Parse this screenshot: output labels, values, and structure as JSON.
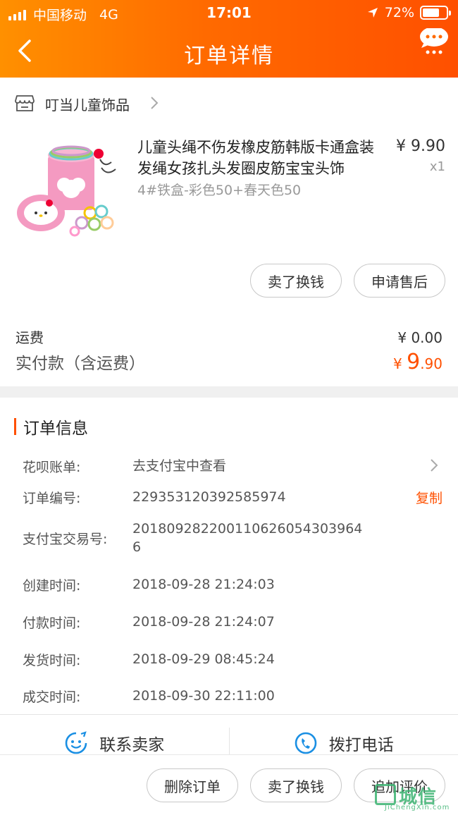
{
  "status_bar": {
    "carrier": "中国移动",
    "network": "4G",
    "time": "17:01",
    "battery": "72%",
    "battery_level": 0.72
  },
  "navbar": {
    "title": "订单详情"
  },
  "shop": {
    "name": "叮当儿童饰品"
  },
  "product": {
    "title": "儿童头绳不伤发橡皮筋韩版卡通盒装发绳女孩扎头发圈皮筋宝宝头饰",
    "variant": "4#铁盒-彩色50+春天色50",
    "price": "¥ 9.90",
    "qty": "x1"
  },
  "item_actions": {
    "sell": "卖了换钱",
    "after_sale": "申请售后"
  },
  "fees": {
    "shipping_label": "运费",
    "shipping_value": "¥ 0.00",
    "total_label": "实付款（含运费）",
    "total_currency": "¥ ",
    "total_int": "9",
    "total_dec": ".90"
  },
  "order_info": {
    "title": "订单信息",
    "huabei_label": "花呗账单:",
    "huabei_value": "去支付宝中查看",
    "order_no_label": "订单编号:",
    "order_no_value": "229353120392585974",
    "copy_label": "复制",
    "alipay_label": "支付宝交易号:",
    "alipay_value_line1": "201809282200110626054303964",
    "alipay_value_line2": "6",
    "created_label": "创建时间:",
    "created_value": "2018-09-28 21:24:03",
    "paid_label": "付款时间:",
    "paid_value": "2018-09-28 21:24:07",
    "shipped_label": "发货时间:",
    "shipped_value": "2018-09-29 08:45:24",
    "closed_label": "成交时间:",
    "closed_value": "2018-09-30 22:11:00"
  },
  "contact": {
    "seller": "联系卖家",
    "phone": "拨打电话"
  },
  "bottom_actions": {
    "delete": "删除订单",
    "sell": "卖了换钱",
    "review": "追加评价"
  },
  "watermark": {
    "text": "城信",
    "sub": "JiChengXin.com"
  },
  "colors": {
    "accent": "#ff5000",
    "header_start": "#ff9000",
    "header_end": "#ff5000",
    "icon_blue": "#1a8fe3"
  }
}
